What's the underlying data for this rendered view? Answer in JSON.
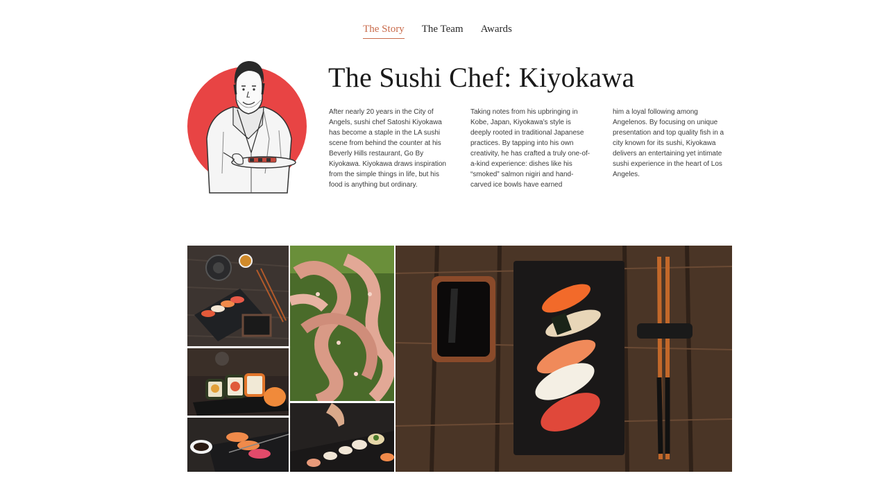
{
  "nav": {
    "tabs": [
      {
        "label": "The Story",
        "active": true
      },
      {
        "label": "The Team",
        "active": false
      },
      {
        "label": "Awards",
        "active": false
      }
    ]
  },
  "hero": {
    "title": "The Sushi Chef: Kiyokawa",
    "paragraph_columns": [
      "After nearly 20 years in the City of Angels, sushi chef Satoshi Kiyokawa has become a staple in the LA sushi scene from behind the counter at his Beverly Hills restaurant, Go By Kiyokawa. Kiyokawa draws inspiration from the simple things in life, but his food is anything but ordinary.",
      "Taking notes from his upbringing in Kobe, Japan, Kiyokawa’s style is deeply rooted in traditional Japanese practices. By tapping into his own creativity, he has crafted a truly one-of-a-kind experience: dishes like his “smoked” salmon nigiri and hand-carved ice bowls have earned",
      "him a loyal following among Angelenos. By focusing on unique presentation and top quality fish in a city known for its sushi, Kiyokawa delivers an entertaining yet intimate sushi experience in the heart of Los Angeles."
    ]
  },
  "colors": {
    "accent": "#c86a4a",
    "circle_red": "#e84444",
    "wood_dark": "#3a2c22"
  },
  "gallery": {
    "images": [
      "teapot-sushi-slate-photo",
      "octopus-tentacles-photo",
      "sushi-set-soy-chopsticks-photo",
      "sushi-rolls-slate-photo",
      "nigiri-soy-slate-photo",
      "chef-hand-sushi-photo"
    ]
  }
}
